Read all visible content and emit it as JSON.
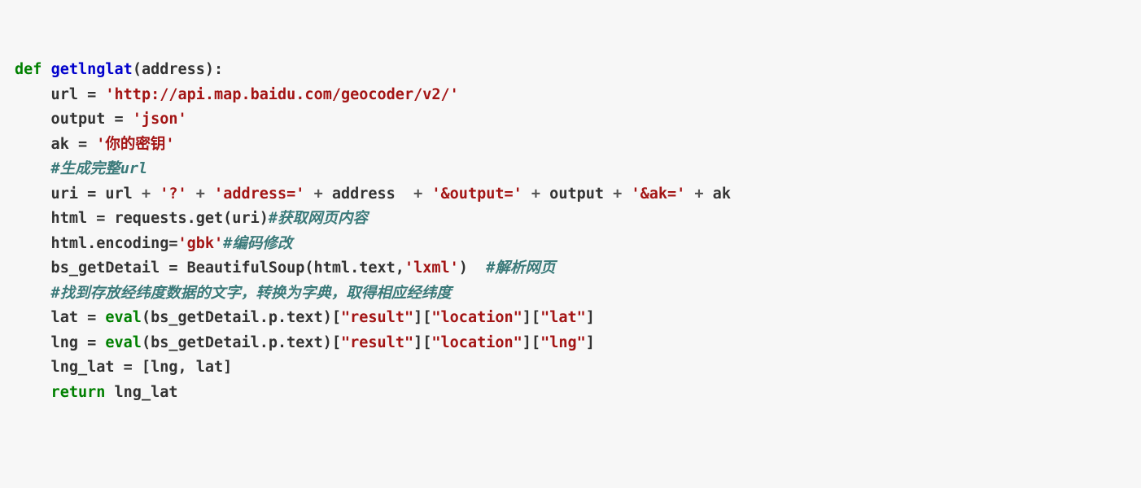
{
  "code": {
    "l1": {
      "def": "def",
      "name": "getlnglat",
      "args": "(address):"
    },
    "l2": {
      "head": "    url = ",
      "str": "'http://api.map.baidu.com/geocoder/v2/'"
    },
    "l3": {
      "head": "    output = ",
      "str": "'json'"
    },
    "l4": {
      "head": "    ak = ",
      "str": "'你的密钥'"
    },
    "l5": {
      "cmt": "    #生成完整url"
    },
    "l6": {
      "a": "    uri = url ",
      "p1": "+",
      "s1": " '?' ",
      "p2": "+",
      "s2": " 'address=' ",
      "p3": "+",
      "b": " address  ",
      "p4": "+",
      "s3": " '&output=' ",
      "p5": "+",
      "c": " output ",
      "p6": "+",
      "s4": " '&ak=' ",
      "p7": "+",
      "d": " ak"
    },
    "l7": {
      "a": "    html = requests.get(uri)",
      "cmt": "#获取网页内容"
    },
    "l8": {
      "a": "    html.encoding=",
      "str": "'gbk'",
      "cmt": "#编码修改"
    },
    "l9": {
      "a": "    bs_getDetail = BeautifulSoup(html.text,",
      "str": "'lxml'",
      "b": ")  ",
      "cmt": "#解析网页"
    },
    "l10": {
      "cmt": "    #找到存放经纬度数据的文字，转换为字典，取得相应经纬度"
    },
    "l11": {
      "a": "    lat = ",
      "ev": "eval",
      "b": "(bs_getDetail.p.text)[",
      "s1": "\"result\"",
      "c": "][",
      "s2": "\"location\"",
      "d": "][",
      "s3": "\"lat\"",
      "e": "]"
    },
    "l12": {
      "a": "    lng = ",
      "ev": "eval",
      "b": "(bs_getDetail.p.text)[",
      "s1": "\"result\"",
      "c": "][",
      "s2": "\"location\"",
      "d": "][",
      "s3": "\"lng\"",
      "e": "]"
    },
    "l13": {
      "a": "    lng_lat = [lng, lat]"
    },
    "l14": {
      "ret": "    return",
      "a": " lng_lat"
    }
  }
}
